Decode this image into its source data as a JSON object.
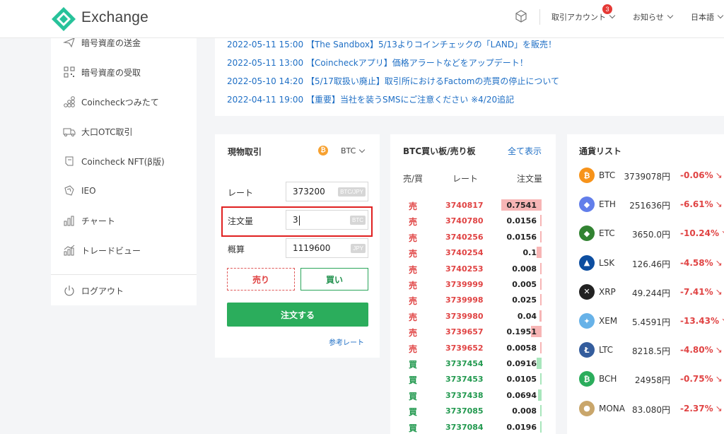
{
  "header": {
    "brand": "Exchange",
    "account_label": "取引アカウント",
    "account_badge": "3",
    "news_label": "お知らせ",
    "lang_label": "日本語"
  },
  "sidebar": {
    "items": [
      {
        "label": "暗号資産の送金",
        "icon": "send-icon"
      },
      {
        "label": "暗号資産の受取",
        "icon": "qr-code-icon"
      },
      {
        "label": "Coincheckつみたて",
        "icon": "coins-stack-icon"
      },
      {
        "label": "大口OTC取引",
        "icon": "truck-icon"
      },
      {
        "label": "Coincheck NFT(β版)",
        "icon": "nft-card-icon"
      },
      {
        "label": "IEO",
        "icon": "ieo-icon"
      },
      {
        "label": "チャート",
        "icon": "bar-chart-icon"
      },
      {
        "label": "トレードビュー",
        "icon": "trade-view-icon"
      }
    ],
    "logout_label": "ログアウト"
  },
  "news": [
    "2022-05-11 15:00 【The Sandbox】5/13よりコインチェックの「LAND」を販売！",
    "2022-05-11 13:00 【Coincheckアプリ】価格アラートなどをアップデート！",
    "2022-05-10 14:20 【5/17取扱い廃止】取引所におけるFactomの売買の停止について",
    "2022-04-11 19:00 【重要】当社を装うSMSにご注意ください ※4/20追記"
  ],
  "order_form": {
    "title": "現物取引",
    "coin_icon": "₿",
    "coin": "BTC",
    "rate_label": "レート",
    "rate_value": "373200",
    "rate_unit": "BTC/JPY",
    "amount_label": "注文量",
    "amount_value": "3",
    "amount_unit": "BTC",
    "estimate_label": "概算",
    "estimate_value": "1119600",
    "estimate_unit": "JPY",
    "sell_label": "売り",
    "buy_label": "買い",
    "submit_label": "注文する",
    "ref_rate_label": "参考レート"
  },
  "order_book": {
    "title": "BTC買い板/売り板",
    "show_all": "全て表示",
    "headers": {
      "side": "売/買",
      "rate": "レート",
      "amount": "注文量"
    },
    "rows": [
      {
        "side": "売",
        "rate": "3740817",
        "amount": "0.7541",
        "depth": 0.54
      },
      {
        "side": "売",
        "rate": "3740780",
        "amount": "0.0156",
        "depth": 0.01
      },
      {
        "side": "売",
        "rate": "3740256",
        "amount": "0.0156",
        "depth": 0.01
      },
      {
        "side": "売",
        "rate": "3740254",
        "amount": "0.1",
        "depth": 0.07
      },
      {
        "side": "売",
        "rate": "3740253",
        "amount": "0.008",
        "depth": 0.01
      },
      {
        "side": "売",
        "rate": "3739999",
        "amount": "0.005",
        "depth": 0.01
      },
      {
        "side": "売",
        "rate": "3739998",
        "amount": "0.025",
        "depth": 0.01
      },
      {
        "side": "売",
        "rate": "3739980",
        "amount": "0.04",
        "depth": 0.03
      },
      {
        "side": "売",
        "rate": "3739657",
        "amount": "0.1951",
        "depth": 0.14
      },
      {
        "side": "売",
        "rate": "3739652",
        "amount": "0.0058",
        "depth": 0.01
      },
      {
        "side": "買",
        "rate": "3737454",
        "amount": "0.0916",
        "depth": 0.07
      },
      {
        "side": "買",
        "rate": "3737453",
        "amount": "0.0105",
        "depth": 0.01
      },
      {
        "side": "買",
        "rate": "3737438",
        "amount": "0.0694",
        "depth": 0.05
      },
      {
        "side": "買",
        "rate": "3737085",
        "amount": "0.008",
        "depth": 0.01
      },
      {
        "side": "買",
        "rate": "3737084",
        "amount": "0.0196",
        "depth": 0.02
      }
    ]
  },
  "currency_list": {
    "title": "通貨リスト",
    "items": [
      {
        "symbol": "BTC",
        "price": "3739078円",
        "change": "-0.06%",
        "icon": "btc-icon",
        "color": "#f7931a"
      },
      {
        "symbol": "ETH",
        "price": "251636円",
        "change": "-6.61%",
        "icon": "eth-icon",
        "color": "#627eea"
      },
      {
        "symbol": "ETC",
        "price": "3650.0円",
        "change": "-10.24%",
        "icon": "etc-icon",
        "color": "#328332"
      },
      {
        "symbol": "LSK",
        "price": "126.46円",
        "change": "-4.58%",
        "icon": "lsk-icon",
        "color": "#0d4ea0"
      },
      {
        "symbol": "XRP",
        "price": "49.244円",
        "change": "-7.41%",
        "icon": "xrp-icon",
        "color": "#222222"
      },
      {
        "symbol": "XEM",
        "price": "5.4591円",
        "change": "-13.43%",
        "icon": "xem-icon",
        "color": "#67b2e8"
      },
      {
        "symbol": "LTC",
        "price": "8218.5円",
        "change": "-4.80%",
        "icon": "ltc-icon",
        "color": "#345d9d"
      },
      {
        "symbol": "BCH",
        "price": "24958円",
        "change": "-0.75%",
        "icon": "bch-icon",
        "color": "#2bad5c"
      },
      {
        "symbol": "MONA",
        "price": "83.080円",
        "change": "-2.37%",
        "icon": "mona-icon",
        "color": "#c9a66b"
      }
    ]
  }
}
